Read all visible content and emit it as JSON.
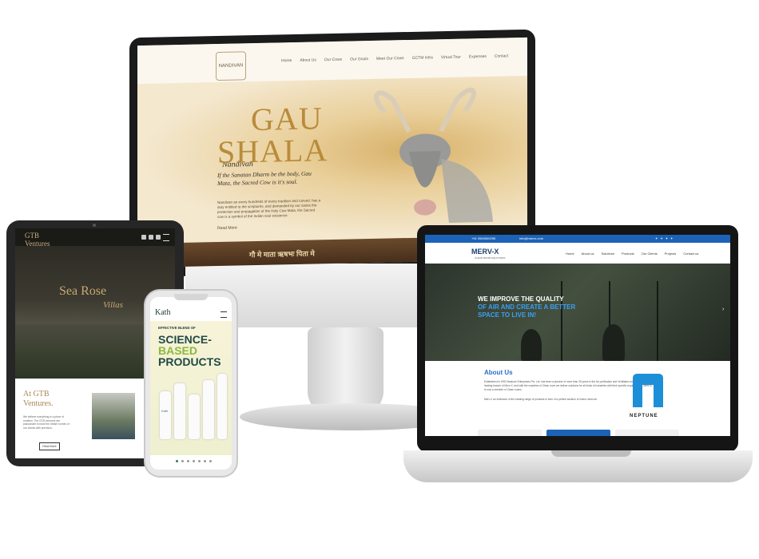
{
  "imac_site": {
    "logo": "NANDIVAN",
    "menu": [
      "Home",
      "About Us",
      "Our Cows",
      "Our Goals",
      "Meet Our Cows",
      "GCTM Infra",
      "Virtual Tour",
      "Expenses",
      "Contact"
    ],
    "pretitle": "Nandivan",
    "title_line1": "GAU",
    "title_line2": "SHALA",
    "quote": "If the Sanatan Dharm be the body, Gau Mata, the Sacred Cow is it's soul.",
    "paragraph": "Nandivan an every hundreds of every tradition and carved. has a duty entitled to the scriptures, and demanded by our saints the protection and propagation of the Holy Cow Mata, the Sacred cow is a symbol of the Indian soul existence.",
    "read_more": "Read More",
    "strip_text": "गौ मे माता ऋषभः पिता मे"
  },
  "laptop_site": {
    "top_phone": "+91 9560500095",
    "top_email": "info@mervx.com",
    "logo": "MERV-X",
    "logo_sub": "CLEAN ROOM SOLUTIONS",
    "menu": [
      "Home",
      "About us",
      "Solutions",
      "Products",
      "Our Clients",
      "Projects",
      "Contact us"
    ],
    "hero_line1": "WE IMPROVE THE QUALITY",
    "hero_line2": "OF AIR AND CREATE A BETTER SPACE TO LIVE IN!",
    "about_title": "About Us",
    "about_text": "Established in 1993 Neptune Enterprises Pvt. Ltd. has been a pioneer of more than 25 years in the Air purification and Ventilation industry. With its leading branch of Merv-X, and with the expertise of Clean room we deliver solutions for all kinds of industries with their specific requirements. Merv-X is now a member of Clean rooms.",
    "about_text2": "Merv-X an extension of the existing range of products in form of a perfect solution of indoor clean air.",
    "partner_logo": "NEPTUNE",
    "brand_blue": "#1c63b7"
  },
  "tablet_site": {
    "logo_line1": "GTB",
    "logo_line2": "Ventures",
    "hero_title": "Sea Rose",
    "hero_subtitle": "Villas",
    "section_title_line1": "At GTB",
    "section_title_line2": "Ventures.",
    "section_text": "We believe everything is a piece of creation. The GTB ventures are passionate to build the dream homes of our clients with precision.",
    "read_more": "Read More"
  },
  "phone_site": {
    "logo": "Kath",
    "pretitle": "EFFECTIVE BLEND OF",
    "headline1": "SCIENCE-",
    "headline2": "BASED",
    "headline3": "PRODUCTS",
    "bottle_label": "Kath",
    "active_dot": 0,
    "dot_count": 7
  }
}
